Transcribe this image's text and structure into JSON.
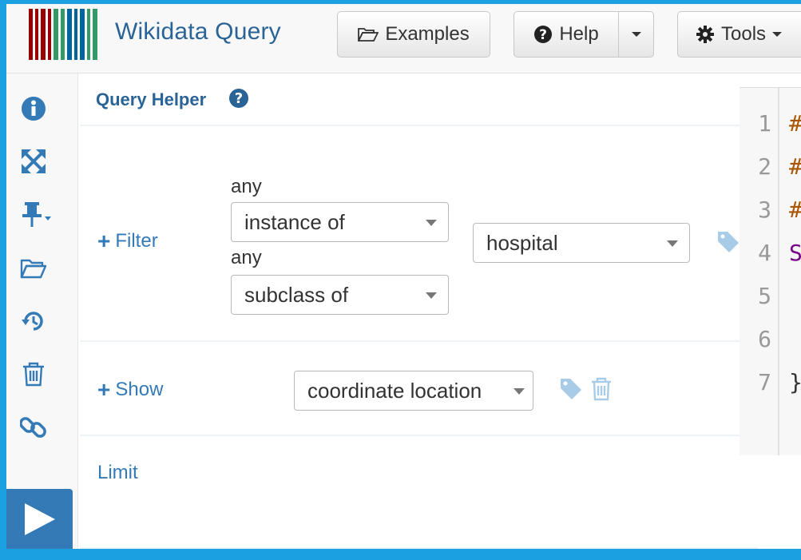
{
  "header": {
    "brand": "Wikidata Query",
    "examples_label": "Examples",
    "help_label": "Help",
    "tools_label": "Tools",
    "icons": [
      "wikidata-barcode-logo",
      "folder-open-icon",
      "question-circle-icon",
      "gear-icon"
    ]
  },
  "sidebar": {
    "icons": [
      "info-icon",
      "expand-icon",
      "pin-icon",
      "folder-open-icon",
      "history-icon",
      "trash-icon",
      "link-icon",
      "play-icon"
    ]
  },
  "helper": {
    "title": "Query Helper",
    "filter": {
      "link_label": "Filter",
      "any1": "any",
      "property1": "instance of",
      "any2": "any",
      "property2": "subclass of",
      "value": "hospital"
    },
    "show": {
      "link_label": "Show",
      "property": "coordinate location"
    },
    "limit": {
      "link_label": "Limit"
    }
  },
  "editor": {
    "line_numbers": [
      "1",
      "2",
      "3",
      "4",
      "5",
      "6",
      "7"
    ],
    "lines": [
      "#",
      "#",
      "#",
      "S",
      "",
      "",
      "}"
    ]
  },
  "colors": {
    "background_accent": "#1ba1e2",
    "link": "#337ab7",
    "brand": "#2a6496",
    "comment": "#aa5500",
    "keyword": "#770088"
  }
}
